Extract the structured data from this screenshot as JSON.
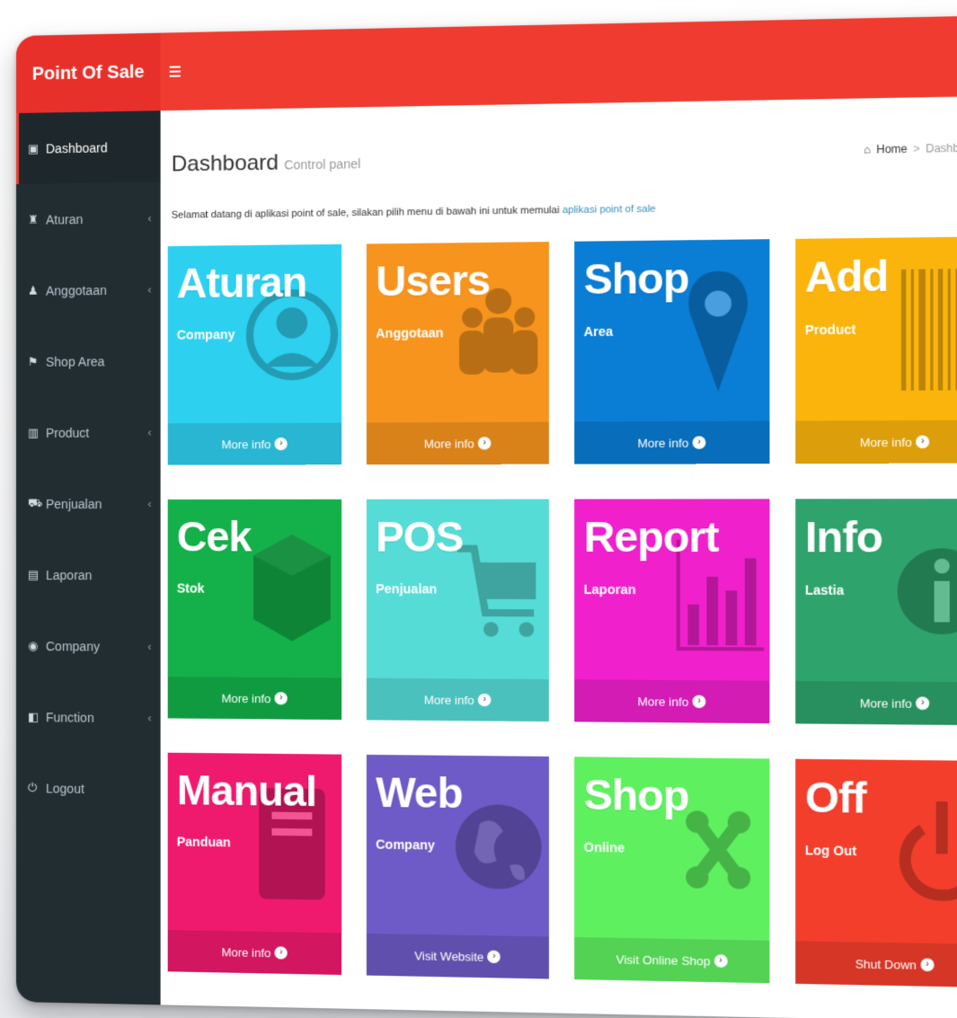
{
  "brand": "Point Of Sale",
  "sidebar": {
    "items": [
      {
        "label": "Dashboard",
        "icon": "dashboard-icon",
        "glyph": "▣",
        "has_children": false,
        "active": true
      },
      {
        "label": "Aturan",
        "icon": "users-icon",
        "glyph": "♜",
        "has_children": true,
        "active": false
      },
      {
        "label": "Anggotaan",
        "icon": "user-group-icon",
        "glyph": "♟",
        "has_children": true,
        "active": false
      },
      {
        "label": "Shop Area",
        "icon": "map-marker-icon",
        "glyph": "⚑",
        "has_children": false,
        "active": false
      },
      {
        "label": "Product",
        "icon": "barcode-icon",
        "glyph": "▥",
        "has_children": true,
        "active": false
      },
      {
        "label": "Penjualan",
        "icon": "cart-icon",
        "glyph": "⛟",
        "has_children": true,
        "active": false
      },
      {
        "label": "Laporan",
        "icon": "chart-icon",
        "glyph": "▤",
        "has_children": false,
        "active": false
      },
      {
        "label": "Company",
        "icon": "globe-icon",
        "glyph": "◉",
        "has_children": true,
        "active": false
      },
      {
        "label": "Function",
        "icon": "book-icon",
        "glyph": "◧",
        "has_children": true,
        "active": false
      },
      {
        "label": "Logout",
        "icon": "power-icon",
        "glyph": "⏻",
        "has_children": false,
        "active": false
      }
    ],
    "chevron": "‹"
  },
  "header": {
    "title": "Dashboard",
    "subtitle": "Control panel",
    "breadcrumb": {
      "home": "Home",
      "separator": ">",
      "current": "Dashboard"
    }
  },
  "welcome": {
    "text": "Selamat datang di aplikasi point of sale, silakan pilih menu di bawah ini untuk memulai ",
    "link": "aplikasi point of sale"
  },
  "tiles": [
    {
      "title": "Aturan",
      "sub": "Company",
      "footer": "More info",
      "color": "#2ed0f0",
      "icon": "user-circle-icon"
    },
    {
      "title": "Users",
      "sub": "Anggotaan",
      "footer": "More info",
      "color": "#f7941d",
      "icon": "users-group-icon"
    },
    {
      "title": "Shop",
      "sub": "Area",
      "footer": "More info",
      "color": "#0a7dd4",
      "icon": "map-marker-icon"
    },
    {
      "title": "Add",
      "sub": "Product",
      "footer": "More info",
      "color": "#fbb40c",
      "icon": "barcode-icon"
    },
    {
      "title": "Cek",
      "sub": "Stok",
      "footer": "More info",
      "color": "#14b14a",
      "icon": "cube-icon"
    },
    {
      "title": "POS",
      "sub": "Penjualan",
      "footer": "More info",
      "color": "#55dcd6",
      "icon": "cart-icon"
    },
    {
      "title": "Report",
      "sub": "Laporan",
      "footer": "More info",
      "color": "#f020cc",
      "icon": "bar-chart-icon"
    },
    {
      "title": "Info",
      "sub": "Lastia",
      "footer": "More info",
      "color": "#2ea46c",
      "icon": "info-icon"
    },
    {
      "title": "Manual",
      "sub": "Panduan",
      "footer": "More info",
      "color": "#ef1a6e",
      "icon": "book-icon"
    },
    {
      "title": "Web",
      "sub": "Company",
      "footer": "Visit Website",
      "color": "#6f5bc7",
      "icon": "globe-icon"
    },
    {
      "title": "Shop",
      "sub": "Online",
      "footer": "Visit Online Shop",
      "color": "#5ff060",
      "icon": "joomla-icon"
    },
    {
      "title": "Off",
      "sub": "Log Out",
      "footer": "Shut Down",
      "color": "#f33e2c",
      "icon": "power-icon"
    }
  ]
}
